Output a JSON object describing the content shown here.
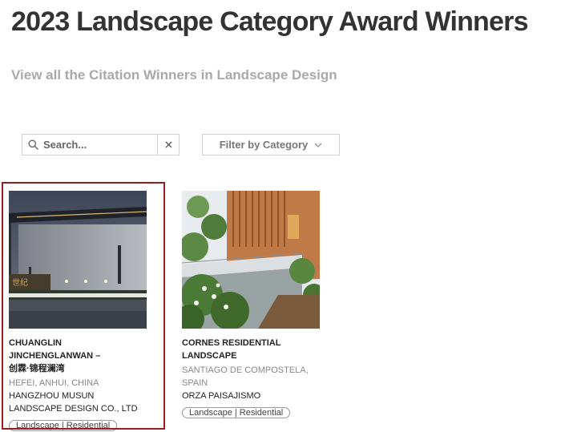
{
  "page": {
    "title": "2023 Landscape Category Award Winners",
    "subtitle": "View all the Citation Winners in Landscape Design"
  },
  "search": {
    "placeholder": "Search...",
    "value": ""
  },
  "filter": {
    "label": "Filter by Category"
  },
  "cards": [
    {
      "title": "CHUANGLIN JINCHENGLANWAN –",
      "subtitle": "创霖·锦程澜湾",
      "location": "HEFEI, ANHUI, CHINA",
      "firm": "HANGZHOU MUSUN LANDSCAPE DESIGN CO., LTD",
      "tag": "Landscape | Residential",
      "selected": true
    },
    {
      "title": "CORNES RESIDENTIAL LANDSCAPE",
      "location": "SANTIAGO DE COMPOSTELA, SPAIN",
      "firm": "ORZA PAISAJISMO",
      "tag": "Landscape | Residential"
    }
  ],
  "colors": {
    "highlight": "#9b1c20",
    "muted_text": "#a9a9a9"
  },
  "icons": [
    "search-icon",
    "close-icon",
    "chevron-down-icon"
  ]
}
